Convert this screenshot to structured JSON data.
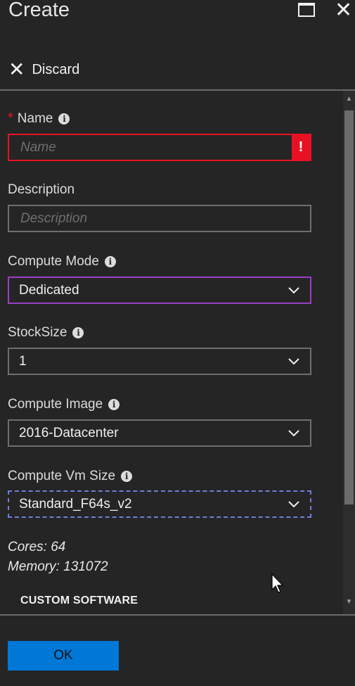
{
  "window": {
    "title": "Create"
  },
  "toolbar": {
    "discard_label": "Discard"
  },
  "form": {
    "name": {
      "label": "Name",
      "placeholder": "Name",
      "required_marker": "*",
      "error_marker": "!"
    },
    "description": {
      "label": "Description",
      "placeholder": "Description"
    },
    "compute_mode": {
      "label": "Compute Mode",
      "value": "Dedicated"
    },
    "stock_size": {
      "label": "StockSize",
      "value": "1"
    },
    "compute_image": {
      "label": "Compute Image",
      "value": "2016-Datacenter"
    },
    "compute_vm_size": {
      "label": "Compute Vm Size",
      "value": "Standard_F64s_v2"
    },
    "vm_info": {
      "cores": "Cores: 64",
      "memory": "Memory: 131072"
    },
    "section": {
      "custom_software": "CUSTOM SOFTWARE"
    }
  },
  "footer": {
    "ok_label": "OK"
  },
  "colors": {
    "background": "#252526",
    "accent": "#0078d7",
    "error": "#e81123",
    "focus_purple": "#9b3ec2"
  }
}
